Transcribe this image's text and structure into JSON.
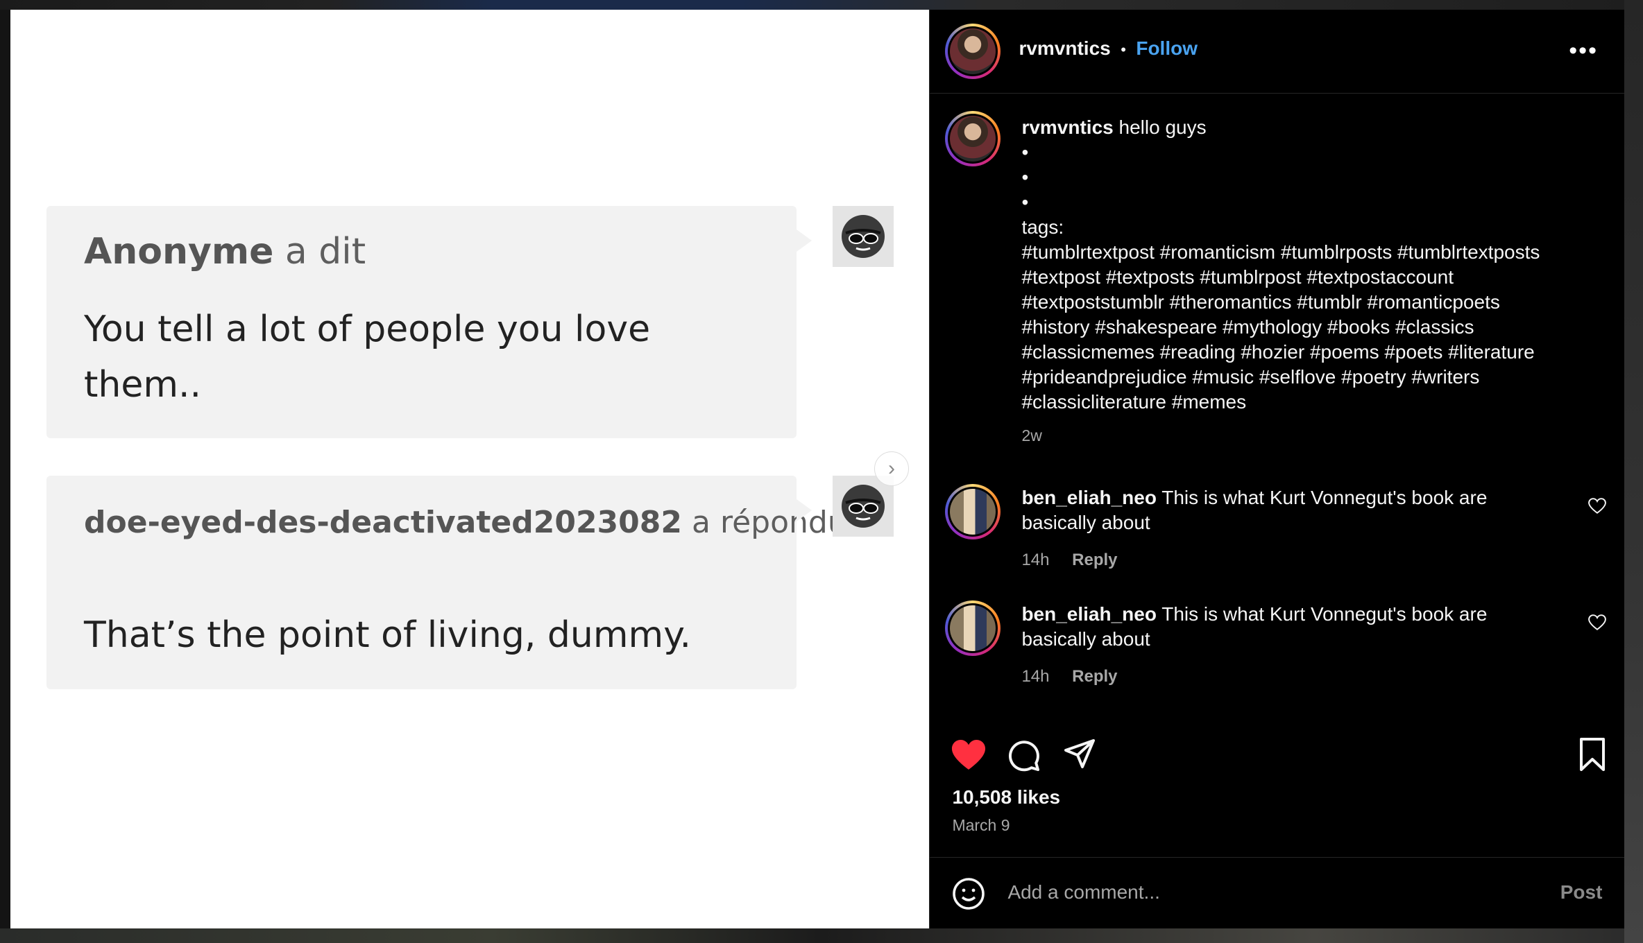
{
  "image": {
    "ask": {
      "author": "Anonyme",
      "verb": "a dit",
      "text": "You tell a lot of people you love them.."
    },
    "answer": {
      "author": "doe-eyed-des-deactivated2023082",
      "verb": "a répondu",
      "text": "That’s the point of living, dummy."
    }
  },
  "post": {
    "username": "rvmvntics",
    "follow_label": "Follow",
    "dot": "•",
    "more_label": "•••"
  },
  "caption": {
    "username": "rvmvntics",
    "first_line": "hello guys",
    "bullets": [
      "•",
      "•",
      "•"
    ],
    "tags_label": "tags:",
    "hashtag_lines": [
      "#tumblrtextpost #romanticism #tumblrposts #tumblrtextposts",
      "#textpost #textposts #tumblrpost #textpostaccount",
      "#textpoststumblr #theromantics #tumblr #romanticpoets",
      "#history #shakespeare #mythology #books #classics",
      "#classicmemes #reading #hozier #poems #poets #literature",
      "#prideandprejudice #music #selflove #poetry #writers",
      "#classicliterature #memes"
    ],
    "time": "2w"
  },
  "comments": [
    {
      "username": "ben_eliah_neo",
      "text": "This is what Kurt Vonnegut's book are basically about",
      "time": "14h",
      "reply_label": "Reply"
    },
    {
      "username": "ben_eliah_neo",
      "text": "This is what Kurt Vonnegut's book are basically about",
      "time": "14h",
      "reply_label": "Reply"
    }
  ],
  "actions": {
    "liked": true,
    "like_color": "#ff3040"
  },
  "likes": "10,508 likes",
  "date": "March 9",
  "add_comment": {
    "placeholder": "Add a comment...",
    "post_label": "Post"
  },
  "icons": [
    "sunglasses-avatar-icon",
    "chevron-right-icon",
    "more-icon",
    "heart-icon",
    "comment-icon",
    "share-icon",
    "bookmark-icon",
    "emoji-icon"
  ]
}
